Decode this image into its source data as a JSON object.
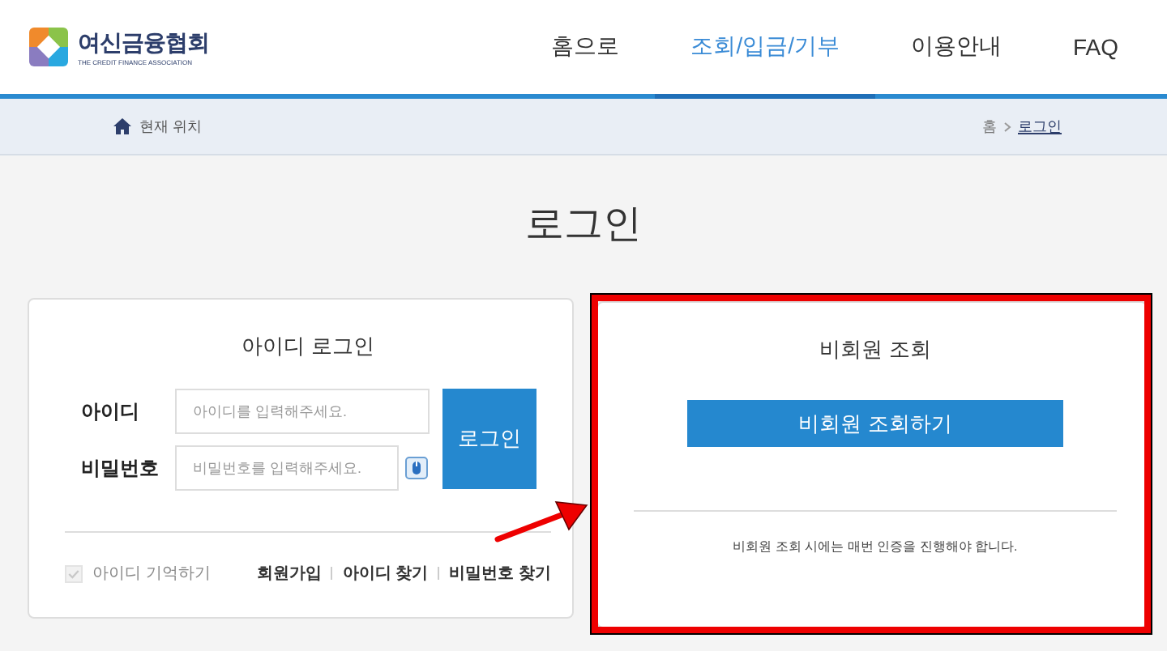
{
  "header": {
    "logo": {
      "name": "여신금융협회",
      "tagline": "THE CREDIT FINANCE ASSOCIATION"
    },
    "nav": [
      {
        "label": "홈으로",
        "selected": false
      },
      {
        "label": "조회/입금/기부",
        "selected": true
      },
      {
        "label": "이용안내",
        "selected": false
      },
      {
        "label": "FAQ",
        "selected": false
      }
    ]
  },
  "breadcrumb": {
    "label": "현재 위치",
    "path": [
      {
        "label": "홈",
        "current": false
      },
      {
        "label": "로그인",
        "current": true
      }
    ]
  },
  "page_title": "로그인",
  "id_login": {
    "title": "아이디 로그인",
    "fields": [
      {
        "label": "아이디",
        "placeholder": "아이디를 입력해주세요.",
        "keypad": false
      },
      {
        "label": "비밀번호",
        "placeholder": "비밀번호를 입력해주세요.",
        "keypad": true
      }
    ],
    "login_button": "로그인",
    "remember": {
      "label": "아이디 기억하기",
      "checked": true,
      "disabled": true
    },
    "links": [
      "회원가입",
      "아이디 찾기",
      "비밀번호 찾기"
    ]
  },
  "guest_lookup": {
    "title": "비회원 조회",
    "button": "비회원 조회하기",
    "note": "비회원 조회 시에는 매번 인증을 진행해야 합니다."
  }
}
